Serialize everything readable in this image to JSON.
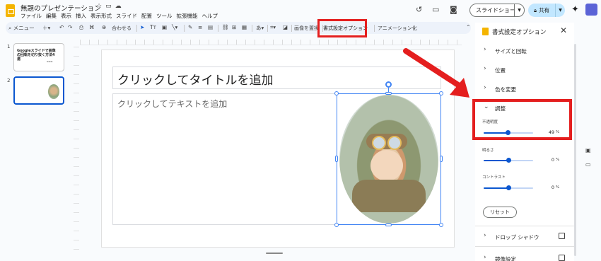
{
  "header": {
    "doc_title": "無題のプレゼンテーション",
    "menu": [
      "ファイル",
      "編集",
      "表示",
      "挿入",
      "表示形式",
      "スライド",
      "配置",
      "ツール",
      "拡張機能",
      "ヘルプ"
    ],
    "slideshow_label": "スライドショー",
    "share_label": "共有"
  },
  "toolbar": {
    "menu_search": "メニュー",
    "zoom_label": "合わせる",
    "replace_image": "画像を置換",
    "format_options": "書式設定オプション",
    "animation": "アニメーション化"
  },
  "thumbnails": [
    {
      "num": "1",
      "text": "Googleスライドで画像の回転を切り抜く方法4選"
    },
    {
      "num": "2",
      "text": ""
    }
  ],
  "slide": {
    "title_placeholder": "クリックしてタイトルを追加",
    "body_placeholder": "クリックしてテキストを追加"
  },
  "panel": {
    "title": "書式設定オプション",
    "sections": [
      {
        "label": "サイズと回転",
        "expanded": false
      },
      {
        "label": "位置",
        "expanded": false
      },
      {
        "label": "色を変更",
        "expanded": false
      },
      {
        "label": "調整",
        "expanded": true
      }
    ],
    "sliders": [
      {
        "label": "不透明度",
        "value": "49",
        "unit": "%",
        "fraction": 0.49
      },
      {
        "label": "明るさ",
        "value": "0",
        "unit": "%",
        "fraction": 0.5
      },
      {
        "label": "コントラスト",
        "value": "0",
        "unit": "%",
        "fraction": 0.5
      }
    ],
    "reset_label": "リセット",
    "drop_shadow": "ドロップ シャドウ",
    "reflection": "鏡像設定"
  },
  "colors": {
    "accent": "#0b57d0",
    "highlight_red": "#e41e1e",
    "share_bg": "#c2e7ff"
  }
}
